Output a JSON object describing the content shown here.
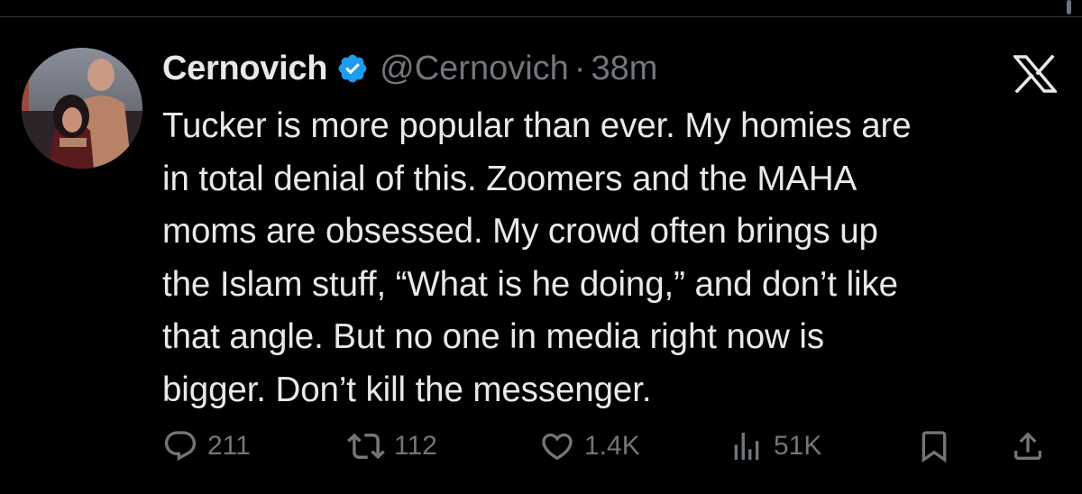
{
  "tweet": {
    "display_name": "Cernovich",
    "handle": "@Cernovich",
    "separator": "·",
    "time": "38m",
    "text_lines": [
      "Tucker is more popular than ever. My homies are",
      "in total denial of this. Zoomers and the MAHA",
      "moms are obsessed. My crowd often brings up",
      "the Islam stuff, “What is he doing,” and don’t like",
      "that angle. But no one in media right now is",
      "bigger. Don’t kill the messenger."
    ],
    "verified": true,
    "verified_color": "#1d9bf0"
  },
  "platform_logo": "x-logo",
  "actions": {
    "reply_count": "211",
    "retweet_count": "112",
    "like_count": "1.4K",
    "views_count": "51K"
  },
  "icons": {
    "reply": "reply-icon",
    "retweet": "retweet-icon",
    "like": "heart-icon",
    "views": "views-icon",
    "bookmark": "bookmark-icon",
    "share": "share-icon"
  },
  "colors": {
    "background": "#000000",
    "text": "#e7e9ea",
    "secondary_text": "#71767b",
    "accent": "#1d9bf0"
  }
}
